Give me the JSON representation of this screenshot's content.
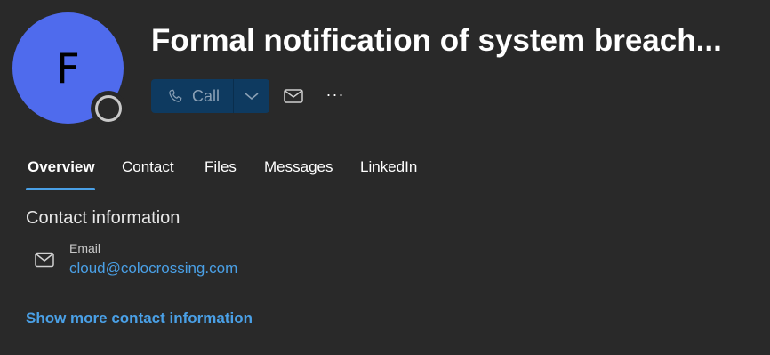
{
  "contact": {
    "avatar_initial": "F",
    "name": "Formal notification of system breach...",
    "avatar_color": "#4f6bed",
    "presence": "offline"
  },
  "actions": {
    "call_label": "Call",
    "call_icon": "phone-icon",
    "call_dropdown_icon": "chevron-down-icon",
    "email_icon": "mail-icon",
    "more_icon": "more-icon",
    "more_label": "···"
  },
  "tabs": [
    {
      "label": "Overview",
      "active": true
    },
    {
      "label": "Contact",
      "active": false
    },
    {
      "label": "Files",
      "active": false
    },
    {
      "label": "Messages",
      "active": false
    },
    {
      "label": "LinkedIn",
      "active": false
    }
  ],
  "contact_info": {
    "section_title": "Contact information",
    "email_label": "Email",
    "email_value": "cloud@colocrossing.com",
    "email_icon": "mail-icon",
    "show_more_label": "Show more contact information"
  },
  "colors": {
    "background": "#292929",
    "accent": "#4aa0e6",
    "call_button": "#0e3a60"
  }
}
